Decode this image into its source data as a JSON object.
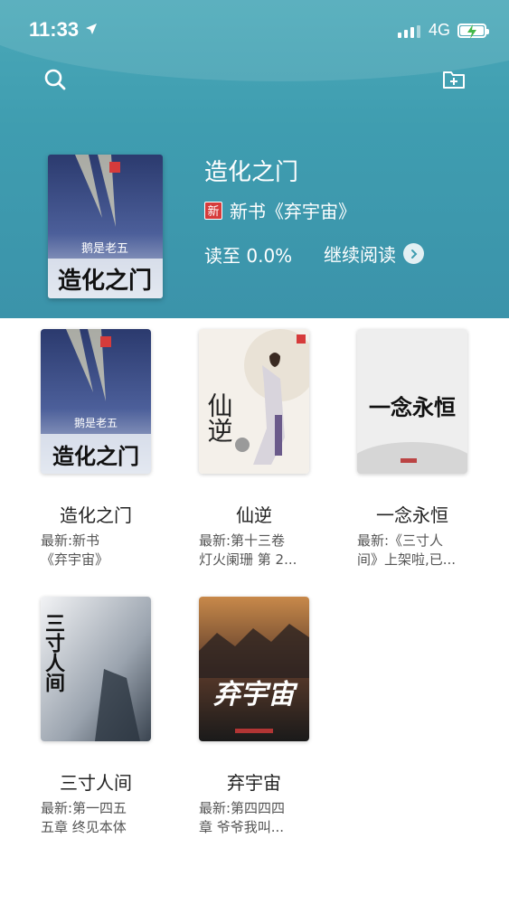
{
  "status_bar": {
    "time": "11:33",
    "network": "4G"
  },
  "hero": {
    "title": "造化之门",
    "new_badge": "新",
    "new_book_text": "新书《弃宇宙》",
    "progress_text": "读至 0.0%",
    "continue_label": "继续阅读",
    "cover_author": "鹅是老五",
    "cover_title": "造化之门"
  },
  "books": [
    {
      "title": "造化之门",
      "latest_line1": "最新:新书",
      "latest_line2": "《弃宇宙》",
      "cover_text": "造化之门",
      "cover_author": "鹅是老五"
    },
    {
      "title": "仙逆",
      "latest_line1": "最新:第十三卷",
      "latest_line2": "灯火阑珊 第 2...",
      "cover_text": "仙逆"
    },
    {
      "title": "一念永恒",
      "latest_line1": "最新:《三寸人",
      "latest_line2": "间》上架啦,已...",
      "cover_text": "一念永恒"
    },
    {
      "title": "三寸人间",
      "latest_line1": "最新:第一四五",
      "latest_line2": "五章 终见本体",
      "cover_text": "三寸人间"
    },
    {
      "title": "弃宇宙",
      "latest_line1": "最新:第四四四",
      "latest_line2": "章 爷爷我叫...",
      "cover_text": "弃宇宙"
    }
  ],
  "icons": [
    "search-icon",
    "folder-add-icon",
    "chevron-right-icon",
    "location-arrow-icon",
    "battery-charging-icon"
  ],
  "colors": {
    "header": "#3f9db0",
    "badge": "#d63b3b"
  }
}
